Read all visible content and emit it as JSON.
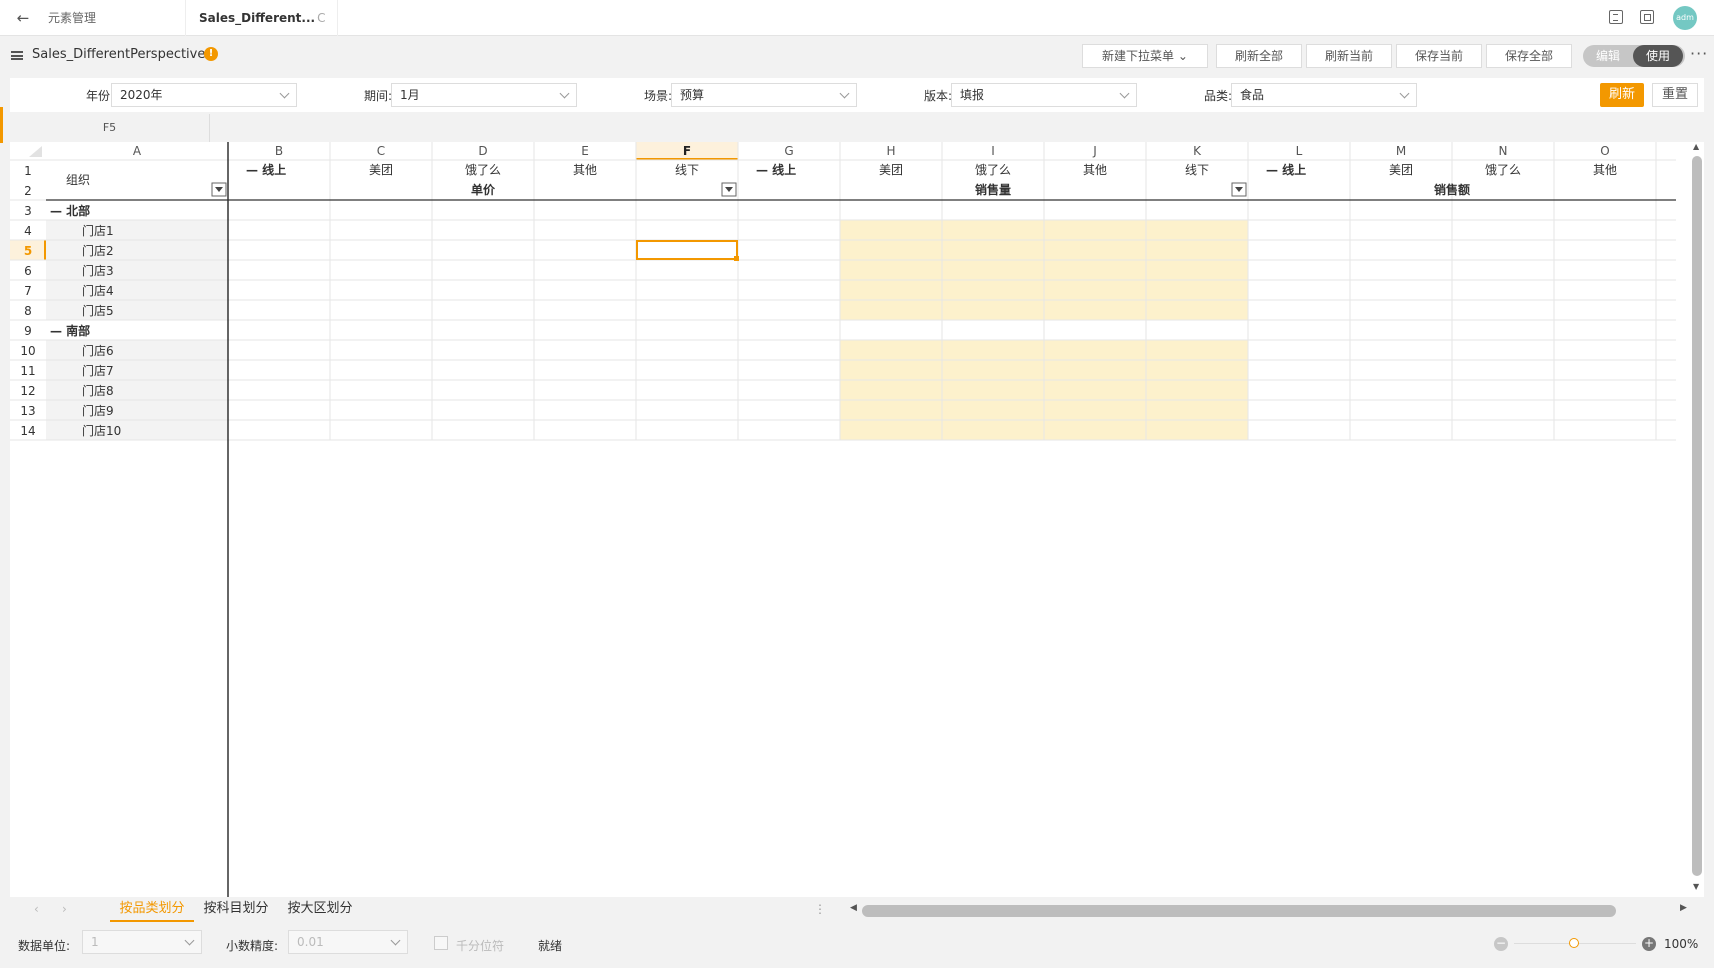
{
  "topbar": {
    "tab1": "元素管理",
    "tab2": "Sales_Different...",
    "tab2_status": "C",
    "avatar": "adm"
  },
  "doc": {
    "name": "Sales_DifferentPerspectives",
    "info": "!",
    "buttons": [
      "新建下拉菜单",
      "刷新全部",
      "刷新当前",
      "保存当前",
      "保存全部"
    ],
    "mode_edit": "编辑",
    "mode_use": "使用",
    "more": "···"
  },
  "filters": [
    {
      "label": "年份:",
      "value": "2020年"
    },
    {
      "label": "期间:",
      "value": "1月"
    },
    {
      "label": "场景:",
      "value": "预算"
    },
    {
      "label": "版本:",
      "value": "填报"
    },
    {
      "label": "品类:",
      "value": "食品"
    }
  ],
  "filter_actions": {
    "refresh": "刷新",
    "reset": "重置"
  },
  "formula": {
    "cell_ref": "F5"
  },
  "sheet": {
    "columns": [
      "A",
      "B",
      "C",
      "D",
      "E",
      "F",
      "G",
      "H",
      "I",
      "J",
      "K",
      "L",
      "M",
      "N",
      "O"
    ],
    "active_column": "F",
    "active_row": 5,
    "row_numbers": [
      1,
      2,
      3,
      4,
      5,
      6,
      7,
      8,
      9,
      10,
      11,
      12,
      13,
      14
    ],
    "header_row1": [
      "— 线上",
      "美团",
      "饿了么",
      "其他",
      "线下",
      "— 线上",
      "美团",
      "饿了么",
      "其他",
      "线下",
      "— 线上",
      "美团",
      "饿了么",
      "其他"
    ],
    "header_org": "组织",
    "group_headers": [
      "单价",
      "销售量",
      "销售额"
    ],
    "rows": [
      "— 北部",
      "门店1",
      "门店2",
      "门店3",
      "门店4",
      "门店5",
      "— 南部",
      "门店6",
      "门店7",
      "门店8",
      "门店9",
      "门店10"
    ],
    "highlight_color": "#fdf1cc",
    "accent": "#f39800"
  },
  "sheet_tabs": [
    "按品类划分",
    "按科目划分",
    "按大区划分"
  ],
  "status": {
    "unit_label": "数据单位:",
    "unit_value": "1",
    "precision_label": "小数精度:",
    "precision_value": "0.01",
    "thousands_label": "千分位符",
    "state": "就绪",
    "zoom": "100%"
  }
}
